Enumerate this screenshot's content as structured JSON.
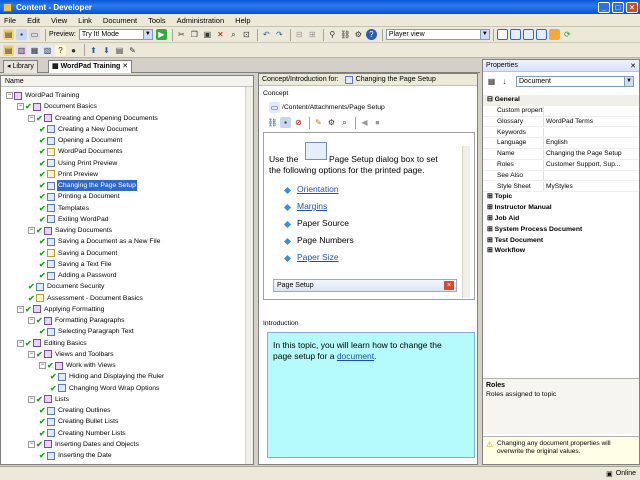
{
  "window": {
    "title": "Content - Developer"
  },
  "menu": [
    "File",
    "Edit",
    "View",
    "Link",
    "Document",
    "Tools",
    "Administration",
    "Help"
  ],
  "toolbar": {
    "preview_label": "Preview:",
    "mode_value": "Try It! Mode",
    "player_value": "Player view"
  },
  "doc_tabs": {
    "library": "Library",
    "active": "WordPad Training"
  },
  "tree": {
    "header": "Name",
    "nodes": [
      {
        "label": "WordPad Training"
      },
      {
        "label": "Document Basics"
      },
      {
        "label": "Creating and Opening Documents"
      },
      {
        "label": "Creating a New Document"
      },
      {
        "label": "Opening a Document"
      },
      {
        "label": "WordPad Documents"
      },
      {
        "label": "Using Print Preview"
      },
      {
        "label": "Print Preview"
      },
      {
        "label": "Changing the Page Setup"
      },
      {
        "label": "Printing a Document"
      },
      {
        "label": "Templates"
      },
      {
        "label": "Exiting WordPad"
      },
      {
        "label": "Saving Documents"
      },
      {
        "label": "Saving a Document as a New File"
      },
      {
        "label": "Saving a Document"
      },
      {
        "label": "Saving a Text File"
      },
      {
        "label": "Adding a Password"
      },
      {
        "label": "Document Security"
      },
      {
        "label": "Assessment - Document Basics"
      },
      {
        "label": "Applying Formatting"
      },
      {
        "label": "Formatting Paragraphs"
      },
      {
        "label": "Selecting Paragraph Text"
      },
      {
        "label": "Editing Basics"
      },
      {
        "label": "Views and Toolbars"
      },
      {
        "label": "Work with Views"
      },
      {
        "label": "Hiding and Displaying the Ruler"
      },
      {
        "label": "Changing Word Wrap Options"
      },
      {
        "label": "Lists"
      },
      {
        "label": "Creating Outlines"
      },
      {
        "label": "Creating Bullet Lists"
      },
      {
        "label": "Creating Number Lists"
      },
      {
        "label": "Inserting Dates and Objects"
      },
      {
        "label": "Inserting the Date"
      }
    ]
  },
  "center": {
    "caption_label": "Concept/Introduction for:",
    "caption_value": "Changing the Page Setup",
    "concept_group": "Concept",
    "concept_path": "/Content/Attachments/Page Setup",
    "concept_text_1": "Use the",
    "concept_text_2": "Page Setup dialog box to set",
    "concept_text_3": "the following options for the printed page.",
    "options": [
      "Orientation",
      "Margins",
      "Paper Source",
      "Page Numbers",
      "Paper Size"
    ],
    "dialog_title": "Page Setup",
    "intro_group": "Introduction",
    "intro_text_1": "In this topic, you will learn how to change the",
    "intro_text_2": "page setup for a",
    "intro_link": "document",
    "intro_end": "."
  },
  "properties": {
    "title": "Properties",
    "combo": "Document",
    "general_label": "General",
    "general": [
      {
        "k": "Custom properties",
        "v": ""
      },
      {
        "k": "Glossary",
        "v": "WordPad Terms"
      },
      {
        "k": "Keywords",
        "v": ""
      },
      {
        "k": "Language",
        "v": "English"
      },
      {
        "k": "Name",
        "v": "Changing the Page Setup"
      },
      {
        "k": "Roles",
        "v": "Customer Support, Sup..."
      },
      {
        "k": "See Also",
        "v": ""
      },
      {
        "k": "Style Sheet",
        "v": "MyStyles"
      }
    ],
    "categories": [
      "Topic",
      "Instructor Manual",
      "Job Aid",
      "System Process Document",
      "Test Document",
      "Workflow"
    ],
    "desc_title": "Roles",
    "desc_text": "Roles assigned to topic",
    "warning": "Changing any document properties will overwrite the original values."
  },
  "status": {
    "online": "Online"
  }
}
